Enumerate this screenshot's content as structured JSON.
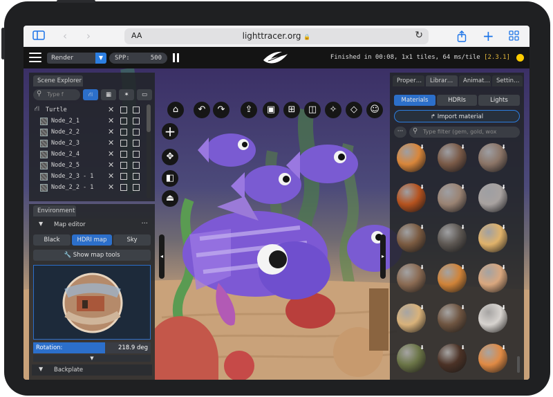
{
  "browser": {
    "text_size_label": "AA",
    "url": "lighttracer.org",
    "lock_icon": "🔒",
    "reload_icon": "↻"
  },
  "toolbar": {
    "render_mode": "Render",
    "spp_label": "SPP:",
    "spp_value": "500",
    "status": "Finished in 00:08, 1x1 tiles, 64 ms/tile",
    "version": "[2.3.1]"
  },
  "scene_explorer": {
    "tab": "Scene Explorer",
    "search_placeholder": "Type f",
    "root": "Turtle",
    "nodes": [
      "Node_2_1",
      "Node_2_2",
      "Node_2_3",
      "Node_2_4",
      "Node_2_5",
      "Node_2_3 - 1",
      "Node_2_2 - 1"
    ]
  },
  "environment": {
    "tab": "Environment",
    "map_editor": "Map editor",
    "map_editor_more": "···",
    "modes": [
      "Black",
      "HDRI map",
      "Sky"
    ],
    "show_map_tools": "Show map tools",
    "rotation_label": "Rotation:",
    "rotation_value": "218.9 deg",
    "backplate": "Backplate"
  },
  "library": {
    "tabs": [
      "Proper…",
      "Librar…",
      "Animat…",
      "Settin…"
    ],
    "subtabs": [
      "Materials",
      "HDRIs",
      "Lights"
    ],
    "import_label": "Import material",
    "filter_placeholder": "Type filter (gem, gold, wox",
    "more": "···",
    "materials": [
      {
        "color": "#d9863a"
      },
      {
        "color": "#7a5a47"
      },
      {
        "color": "#8b7466"
      },
      {
        "color": "#b5521e"
      },
      {
        "color": "#9a8373"
      },
      {
        "color": "#a8a2a0"
      },
      {
        "color": "#7a5a40"
      },
      {
        "color": "#5d5752"
      },
      {
        "color": "#e0b26a"
      },
      {
        "color": "#8a6a52"
      },
      {
        "color": "#d08338"
      },
      {
        "color": "#d9a77e"
      },
      {
        "color": "#d9b27a"
      },
      {
        "color": "#6e5440"
      },
      {
        "color": "#d7d3cf"
      },
      {
        "color": "#6a7446"
      },
      {
        "color": "#4b3226"
      },
      {
        "color": "#e08a44"
      }
    ]
  },
  "colors": {
    "accent": "#2c7ee0",
    "status_dot": "#ffcc00",
    "panel_bg": "#222428"
  }
}
